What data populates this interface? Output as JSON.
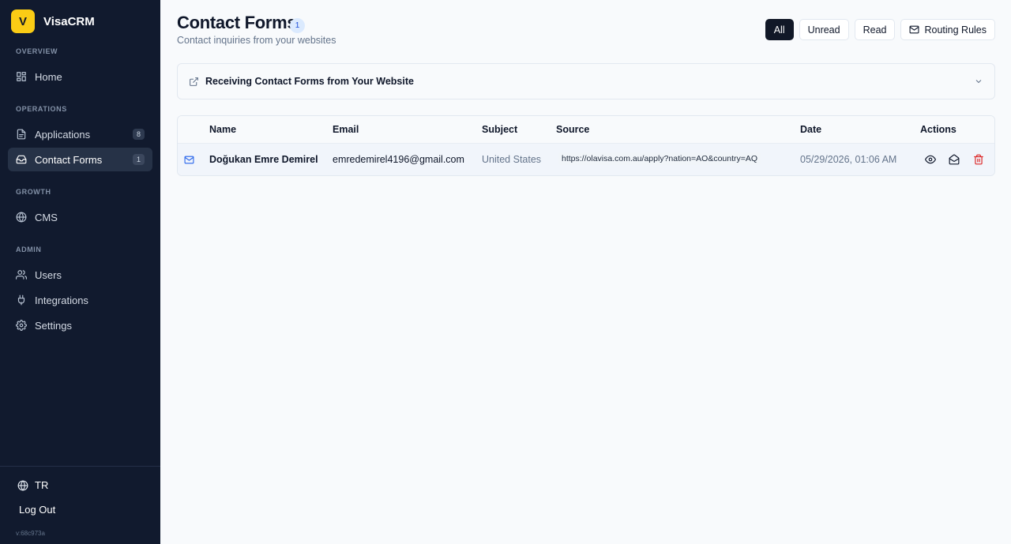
{
  "sidebar": {
    "brand": {
      "logo_letter": "V",
      "name": "VisaCRM"
    },
    "sections": [
      {
        "label": "OVERVIEW"
      },
      {
        "label": "OPERATIONS"
      },
      {
        "label": "GROWTH"
      },
      {
        "label": "ADMIN"
      }
    ],
    "items": [
      {
        "label": "Home",
        "icon": "dashboard-icon"
      },
      {
        "label": "Applications",
        "icon": "file-icon",
        "badge": "8"
      },
      {
        "label": "Contact Forms",
        "icon": "inbox-icon",
        "badge": "1",
        "active": true
      },
      {
        "label": "CMS",
        "icon": "globe-icon"
      },
      {
        "label": "Users",
        "icon": "users-icon"
      },
      {
        "label": "Integrations",
        "icon": "plug-icon"
      },
      {
        "label": "Settings",
        "icon": "gear-icon"
      }
    ],
    "footer": {
      "language": "TR",
      "logout": "Log Out",
      "version": "v:68c973a"
    }
  },
  "header": {
    "title": "Contact Forms",
    "count": "1",
    "subtitle": "Contact inquiries from your websites"
  },
  "filters": {
    "all": "All",
    "unread": "Unread",
    "read": "Read",
    "routing_rules": "Routing Rules",
    "active": "All"
  },
  "accordion": {
    "title": "Receiving Contact Forms from Your Website"
  },
  "table": {
    "columns": [
      "Name",
      "Email",
      "Subject",
      "Source",
      "Date",
      "Actions"
    ],
    "rows": [
      {
        "name": "Doğukan Emre Demirel",
        "email": "emredemirel4196@gmail.com",
        "subject": "United States",
        "source": "https://olavisa.com.au/apply?nation=AO&country=AQ",
        "date": "05/29/2026, 01:06 AM",
        "unread": true
      }
    ]
  },
  "colors": {
    "sidebar_bg": "#111a2e",
    "brand_yellow": "#facc15",
    "accent_blue": "#2563eb",
    "danger": "#dc2626"
  }
}
